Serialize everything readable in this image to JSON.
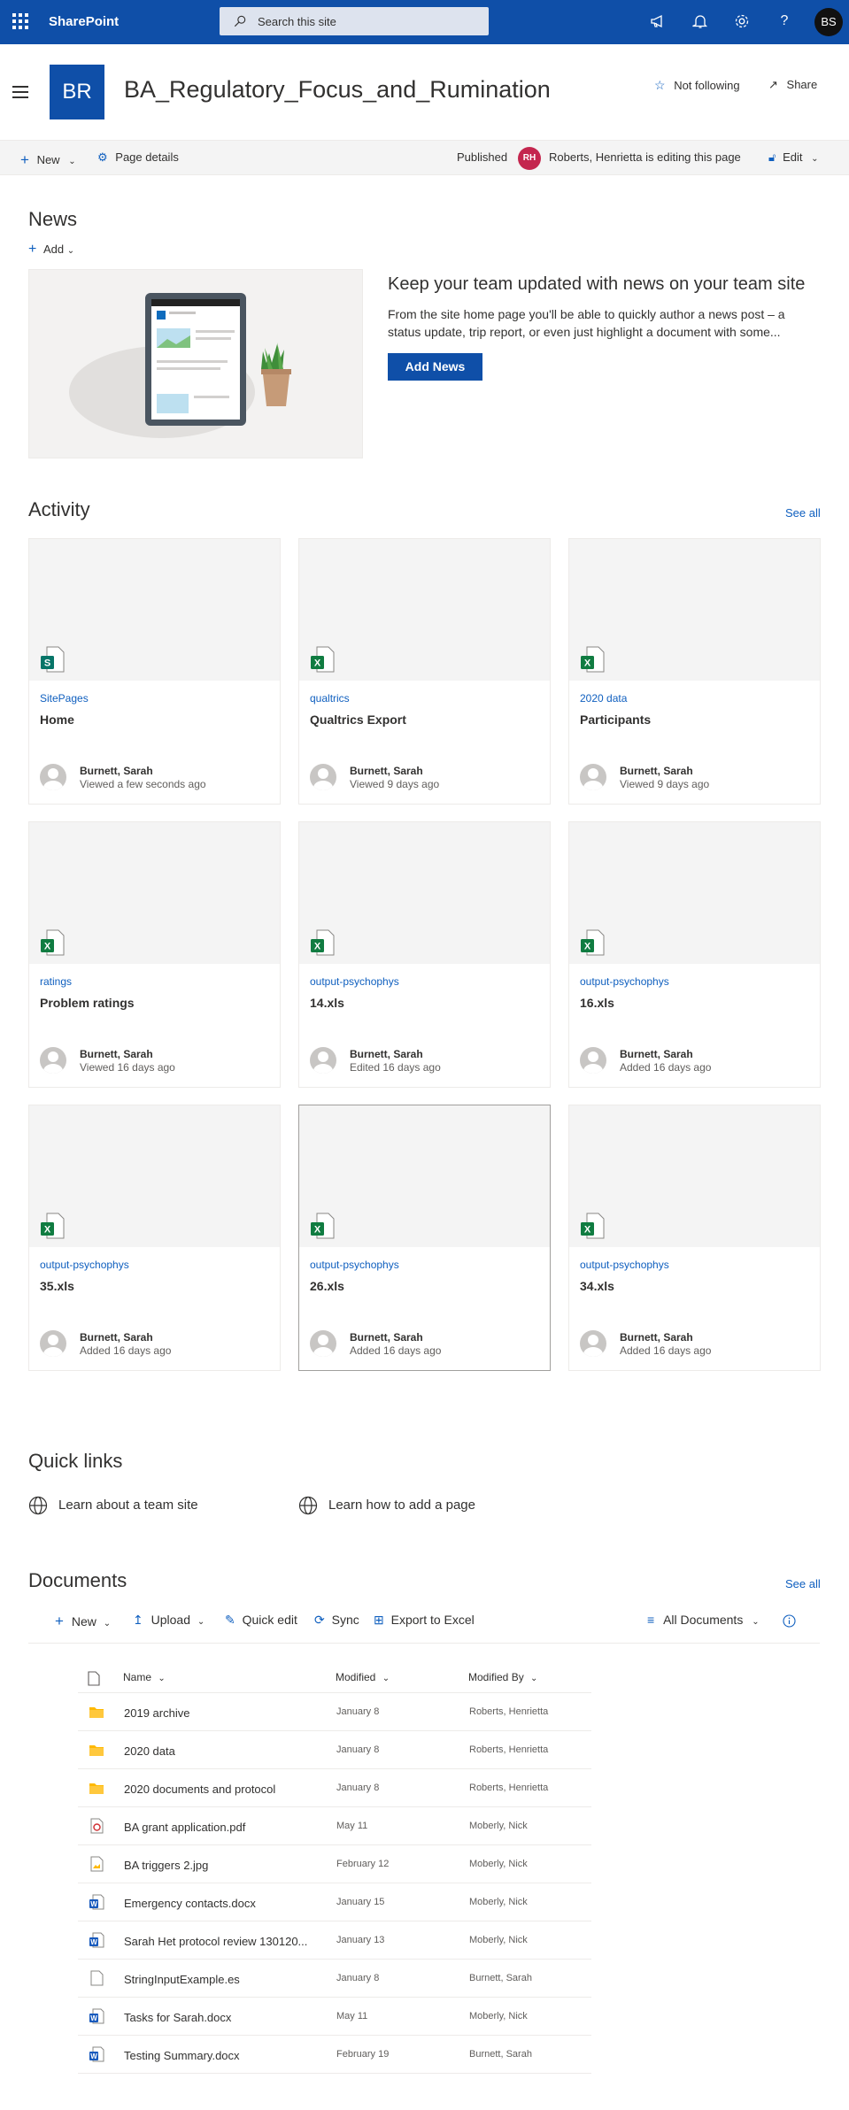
{
  "suitebar": {
    "app_name": "SharePoint",
    "search_placeholder": "Search this site",
    "user_initials": "BS",
    "color": "#0f4fa8"
  },
  "site": {
    "logo_initials": "BR",
    "title": "BA_Regulatory_Focus_and_Rumination",
    "follow_label": "Not following",
    "share_label": "Share"
  },
  "commandbar": {
    "new_label": "New",
    "page_details_label": "Page details",
    "published_label": "Published",
    "editor_initials": "RH",
    "editing_status": "Roberts, Henrietta is editing this page",
    "edit_label": "Edit"
  },
  "news": {
    "title": "News",
    "add_label": "Add",
    "headline": "Keep your team updated with news on your team site",
    "body_line1": "From the site home page you'll be able to quickly author a news post – a",
    "body_line2": "status update, trip report, or even just highlight a document with some...",
    "button_label": "Add News"
  },
  "activity": {
    "title": "Activity",
    "see_all": "See all",
    "cards": [
      {
        "location": "SitePages",
        "name": "Home",
        "icon": "sharepoint-page-icon",
        "user": "Burnett, Sarah",
        "action": "Viewed a few seconds ago"
      },
      {
        "location": "qualtrics",
        "name": "Qualtrics Export",
        "icon": "excel-icon",
        "user": "Burnett, Sarah",
        "action": "Viewed 9 days ago"
      },
      {
        "location": "2020 data",
        "name": "Participants",
        "icon": "excel-icon",
        "user": "Burnett, Sarah",
        "action": "Viewed 9 days ago"
      },
      {
        "location": "ratings",
        "name": "Problem ratings",
        "icon": "excel-icon",
        "user": "Burnett, Sarah",
        "action": "Viewed 16 days ago"
      },
      {
        "location": "output-psychophys",
        "name": "14.xls",
        "icon": "excel-icon",
        "user": "Burnett, Sarah",
        "action": "Edited 16 days ago"
      },
      {
        "location": "output-psychophys",
        "name": "16.xls",
        "icon": "excel-icon",
        "user": "Burnett, Sarah",
        "action": "Added 16 days ago"
      },
      {
        "location": "output-psychophys",
        "name": "35.xls",
        "icon": "excel-icon",
        "user": "Burnett, Sarah",
        "action": "Added 16 days ago"
      },
      {
        "location": "output-psychophys",
        "name": "26.xls",
        "icon": "excel-icon",
        "user": "Burnett, Sarah",
        "action": "Added 16 days ago"
      },
      {
        "location": "output-psychophys",
        "name": "34.xls",
        "icon": "excel-icon",
        "user": "Burnett, Sarah",
        "action": "Added 16 days ago"
      }
    ]
  },
  "quick_links": {
    "title": "Quick links",
    "links": [
      "Learn about a team site",
      "Learn how to add a page"
    ]
  },
  "documents": {
    "title": "Documents",
    "see_all": "See all",
    "commands": {
      "new": "New",
      "upload": "Upload",
      "quick_edit": "Quick edit",
      "sync": "Sync",
      "export": "Export to Excel",
      "view": "All Documents"
    },
    "columns": {
      "name": "Name",
      "modified": "Modified",
      "modified_by": "Modified By"
    },
    "rows": [
      {
        "name": "2019 archive",
        "type": "folder",
        "modified": "January 8",
        "by": "Roberts, Henrietta"
      },
      {
        "name": "2020 data",
        "type": "folder",
        "modified": "January 8",
        "by": "Roberts, Henrietta"
      },
      {
        "name": "2020 documents and protocol",
        "type": "folder",
        "modified": "January 8",
        "by": "Roberts, Henrietta"
      },
      {
        "name": "BA grant application.pdf",
        "type": "pdf",
        "modified": "May 11",
        "by": "Moberly, Nick"
      },
      {
        "name": "BA triggers 2.jpg",
        "type": "image",
        "modified": "February 12",
        "by": "Moberly, Nick"
      },
      {
        "name": "Emergency contacts.docx",
        "type": "word",
        "modified": "January 15",
        "by": "Moberly, Nick"
      },
      {
        "name": "Sarah Het protocol review 130120...",
        "type": "word",
        "modified": "January 13",
        "by": "Moberly, Nick"
      },
      {
        "name": "StringInputExample.es",
        "type": "generic",
        "modified": "January 8",
        "by": "Burnett, Sarah"
      },
      {
        "name": "Tasks for Sarah.docx",
        "type": "word",
        "modified": "May 11",
        "by": "Moberly, Nick"
      },
      {
        "name": "Testing Summary.docx",
        "type": "word",
        "modified": "February 19",
        "by": "Burnett, Sarah"
      }
    ]
  }
}
